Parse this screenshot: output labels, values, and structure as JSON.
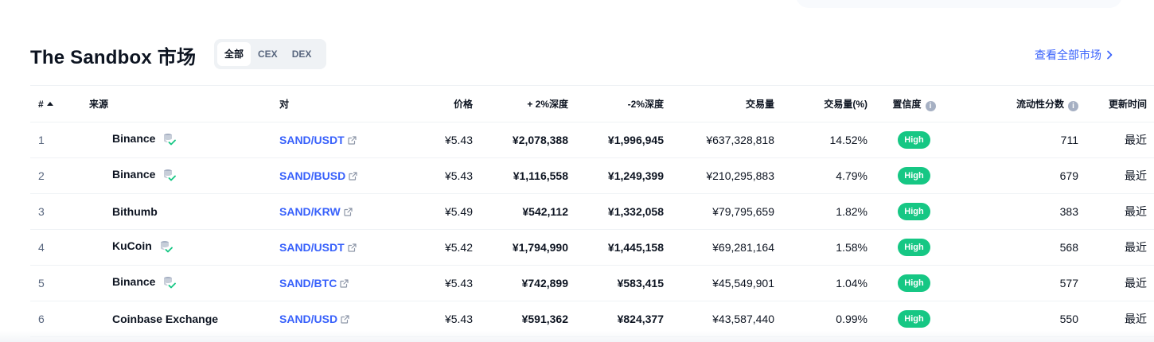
{
  "header": {
    "title": "The Sandbox 市场",
    "tabs": [
      "全部",
      "CEX",
      "DEX"
    ],
    "active_tab": "全部",
    "view_all": "查看全部市场"
  },
  "table": {
    "columns": {
      "rank": "#",
      "source": "来源",
      "pair": "对",
      "price": "价格",
      "depth_plus": "+ 2%深度",
      "depth_minus": "-2%深度",
      "volume": "交易量",
      "volume_pct": "交易量(%)",
      "confidence": "置信度",
      "liquidity": "流动性分数",
      "updated": "更新时间"
    },
    "rows": [
      {
        "rank": "1",
        "source": "Binance",
        "pair": "SAND/USDT",
        "price": "¥5.43",
        "depth_plus": "¥2,078,388",
        "depth_minus": "¥1,996,945",
        "volume": "¥637,328,818",
        "volume_pct": "14.52%",
        "confidence": "High",
        "liquidity": "711",
        "updated": "最近",
        "verified": true
      },
      {
        "rank": "2",
        "source": "Binance",
        "pair": "SAND/BUSD",
        "price": "¥5.43",
        "depth_plus": "¥1,116,558",
        "depth_minus": "¥1,249,399",
        "volume": "¥210,295,883",
        "volume_pct": "4.79%",
        "confidence": "High",
        "liquidity": "679",
        "updated": "最近",
        "verified": true
      },
      {
        "rank": "3",
        "source": "Bithumb",
        "pair": "SAND/KRW",
        "price": "¥5.49",
        "depth_plus": "¥542,112",
        "depth_minus": "¥1,332,058",
        "volume": "¥79,795,659",
        "volume_pct": "1.82%",
        "confidence": "High",
        "liquidity": "383",
        "updated": "最近",
        "verified": false
      },
      {
        "rank": "4",
        "source": "KuCoin",
        "pair": "SAND/USDT",
        "price": "¥5.42",
        "depth_plus": "¥1,794,990",
        "depth_minus": "¥1,445,158",
        "volume": "¥69,281,164",
        "volume_pct": "1.58%",
        "confidence": "High",
        "liquidity": "568",
        "updated": "最近",
        "verified": true
      },
      {
        "rank": "5",
        "source": "Binance",
        "pair": "SAND/BTC",
        "price": "¥5.43",
        "depth_plus": "¥742,899",
        "depth_minus": "¥583,415",
        "volume": "¥45,549,901",
        "volume_pct": "1.04%",
        "confidence": "High",
        "liquidity": "577",
        "updated": "最近",
        "verified": true
      },
      {
        "rank": "6",
        "source": "Coinbase Exchange",
        "pair": "SAND/USD",
        "price": "¥5.43",
        "depth_plus": "¥591,362",
        "depth_minus": "¥824,377",
        "volume": "¥43,587,440",
        "volume_pct": "0.99%",
        "confidence": "High",
        "liquidity": "550",
        "updated": "最近",
        "verified": false
      }
    ]
  },
  "colors": {
    "accent": "#3861fb",
    "high_badge": "#16c784",
    "text": "#0d1421",
    "muted": "#58667e"
  }
}
